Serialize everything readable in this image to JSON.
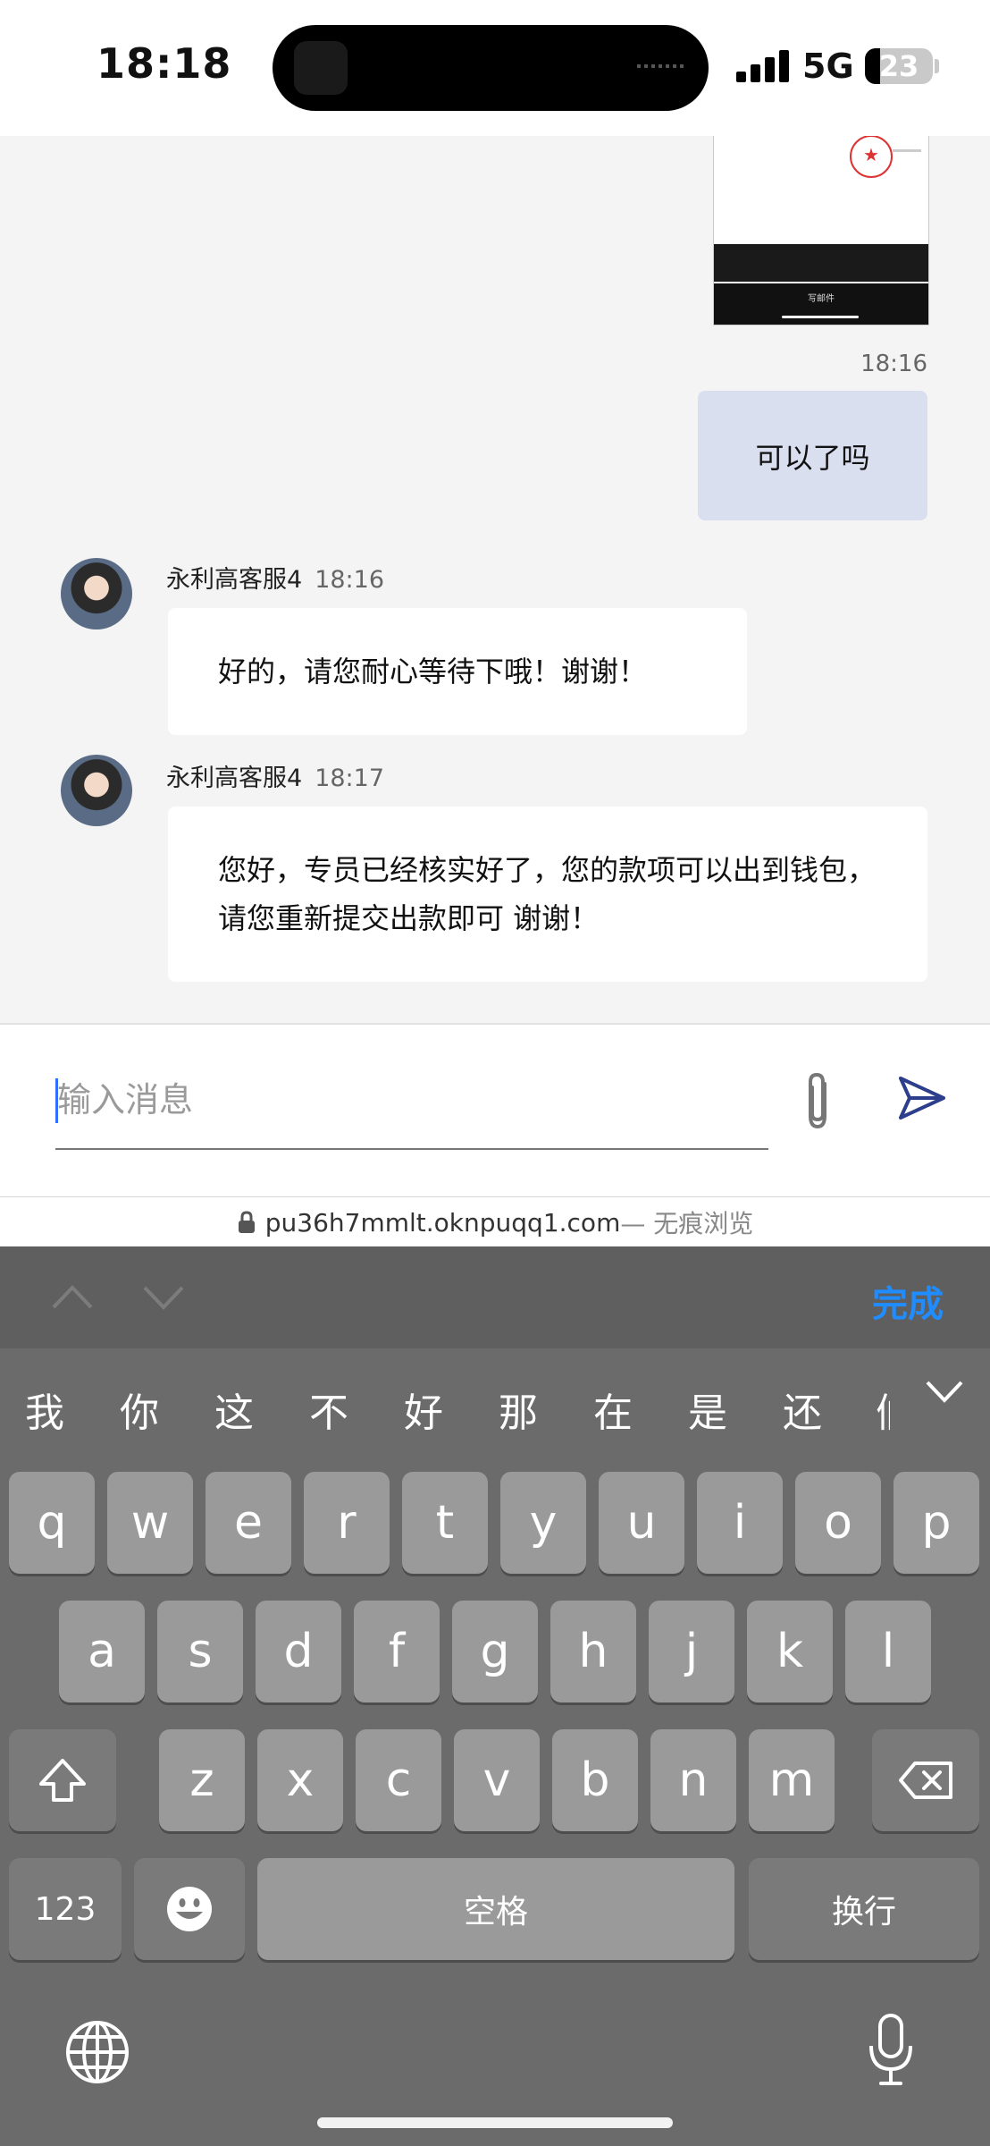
{
  "status_bar": {
    "time": "18:18",
    "network": "5G",
    "battery": "23",
    "battery_level_percent": 23
  },
  "chat": {
    "image_message_caption": "写邮件",
    "my_message": {
      "time": "18:16",
      "text": "可以了吗"
    },
    "messages": [
      {
        "sender": "永利高客服4",
        "time": "18:16",
        "text": "好的，请您耐心等待下哦！谢谢！"
      },
      {
        "sender": "永利高客服4",
        "time": "18:17",
        "text": "您好，专员已经核实好了，您的款项可以出到钱包，请您重新提交出款即可 谢谢！"
      }
    ]
  },
  "composer": {
    "placeholder": "输入消息",
    "value": ""
  },
  "url_bar": {
    "domain": "pu36h7mmlt.oknpuqq1.com",
    "mode": " — 无痕浏览"
  },
  "keyboard": {
    "done_label": "完成",
    "candidates": [
      "我",
      "你",
      "这",
      "不",
      "好",
      "那",
      "在",
      "是",
      "还",
      "们"
    ],
    "row1": [
      "q",
      "w",
      "e",
      "r",
      "t",
      "y",
      "u",
      "i",
      "o",
      "p"
    ],
    "row2": [
      "a",
      "s",
      "d",
      "f",
      "g",
      "h",
      "j",
      "k",
      "l"
    ],
    "row3": [
      "z",
      "x",
      "c",
      "v",
      "b",
      "n",
      "m"
    ],
    "numbers_label": "123",
    "space_label": "空格",
    "return_label": "换行"
  }
}
